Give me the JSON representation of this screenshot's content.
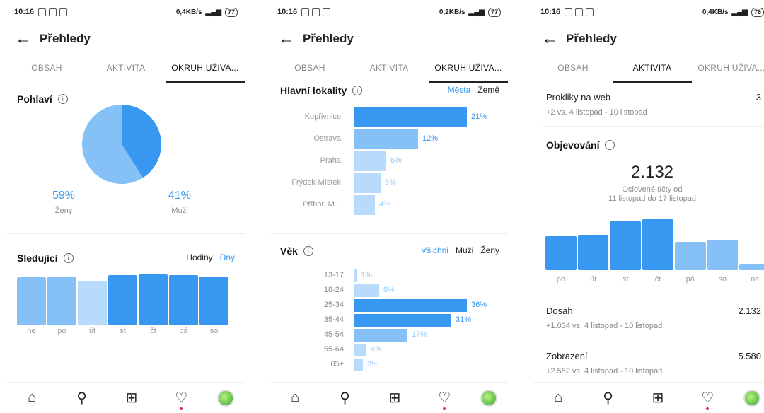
{
  "screens": [
    {
      "status": {
        "time": "10:16",
        "speed": "0,4KB/s",
        "battery": "77"
      },
      "title": "Přehledy",
      "tabs": [
        "OBSAH",
        "AKTIVITA",
        "OKRUH UŽIVA..."
      ],
      "active_tab": 2,
      "gender": {
        "title": "Pohlaví",
        "women_pct": "59%",
        "women_label": "Ženy",
        "men_pct": "41%",
        "men_label": "Muži"
      },
      "followers": {
        "title": "Sledující",
        "toggle": [
          "Hodiny",
          "Dny"
        ],
        "days": [
          "ne",
          "po",
          "út",
          "st",
          "čt",
          "pá",
          "so"
        ]
      }
    },
    {
      "status": {
        "time": "10:16",
        "speed": "0,2KB/s",
        "battery": "77"
      },
      "title": "Přehledy",
      "tabs": [
        "OBSAH",
        "AKTIVITA",
        "OKRUH UŽIVA..."
      ],
      "active_tab": 2,
      "locations": {
        "title": "Hlavní lokality",
        "toggle": [
          "Města",
          "Země"
        ],
        "rows": [
          {
            "name": "Kopřivnice",
            "value": "21%"
          },
          {
            "name": "Ostrava",
            "value": "12%"
          },
          {
            "name": "Praha",
            "value": "6%"
          },
          {
            "name": "Frýdek-Místek",
            "value": "5%"
          },
          {
            "name": "Příbor, M...",
            "value": "4%"
          }
        ]
      },
      "age": {
        "title": "Věk",
        "toggle": [
          "Všichni",
          "Muži",
          "Ženy"
        ],
        "rows": [
          {
            "range": "13-17",
            "value": "1%"
          },
          {
            "range": "18-24",
            "value": "8%"
          },
          {
            "range": "25-34",
            "value": "36%"
          },
          {
            "range": "35-44",
            "value": "31%"
          },
          {
            "range": "45-54",
            "value": "17%"
          },
          {
            "range": "55-64",
            "value": "4%"
          },
          {
            "range": "65+",
            "value": "3%"
          }
        ]
      }
    },
    {
      "status": {
        "time": "10:16",
        "speed": "0,4KB/s",
        "battery": "76"
      },
      "title": "Přehledy",
      "tabs": [
        "OBSAH",
        "AKTIVITA",
        "OKRUH UŽIVA..."
      ],
      "active_tab": 1,
      "web_clicks": {
        "label": "Prokliky na web",
        "value": "3",
        "sub": "+2 vs. 4 listopad - 10 listopad"
      },
      "discovery": {
        "title": "Objevování",
        "total": "2.132",
        "caption1": "Oslovené účty od",
        "caption2": "11 listopad do 17 listopad",
        "days": [
          "po",
          "út",
          "st",
          "čt",
          "pá",
          "so",
          "ne"
        ]
      },
      "reach": {
        "label": "Dosah",
        "value": "2.132",
        "sub": "+1.034 vs. 4 listopad - 10 listopad"
      },
      "impressions": {
        "label": "Zobrazení",
        "value": "5.580",
        "sub": "+2.552 vs. 4 listopad - 10 listopad"
      }
    }
  ],
  "nav_icons": [
    "home-icon",
    "search-icon",
    "add-icon",
    "heart-icon",
    "profile-avatar"
  ],
  "chart_data": [
    {
      "type": "pie",
      "categories": [
        "Ženy",
        "Muži"
      ],
      "values": [
        59,
        41
      ]
    },
    {
      "type": "bar",
      "categories": [
        "ne",
        "po",
        "út",
        "st",
        "čt",
        "pá",
        "so"
      ],
      "values": [
        62,
        63,
        58,
        65,
        66,
        65,
        63
      ]
    },
    {
      "type": "bar",
      "categories": [
        "Kopřivnice",
        "Ostrava",
        "Praha",
        "Frýdek-Místek",
        "Příbor, M..."
      ],
      "values": [
        21,
        12,
        6,
        5,
        4
      ]
    },
    {
      "type": "bar",
      "categories": [
        "13-17",
        "18-24",
        "25-34",
        "35-44",
        "45-54",
        "55-64",
        "65+"
      ],
      "values": [
        1,
        8,
        36,
        31,
        17,
        4,
        3
      ]
    },
    {
      "type": "bar",
      "categories": [
        "po",
        "út",
        "st",
        "čt",
        "pá",
        "so",
        "ne"
      ],
      "values": [
        44,
        45,
        63,
        66,
        37,
        39,
        7
      ]
    }
  ],
  "colors": {
    "dark": "#3897f0",
    "mid": "#85c1f7",
    "light": "#b9dbfb",
    "accent": "#3897f0"
  }
}
